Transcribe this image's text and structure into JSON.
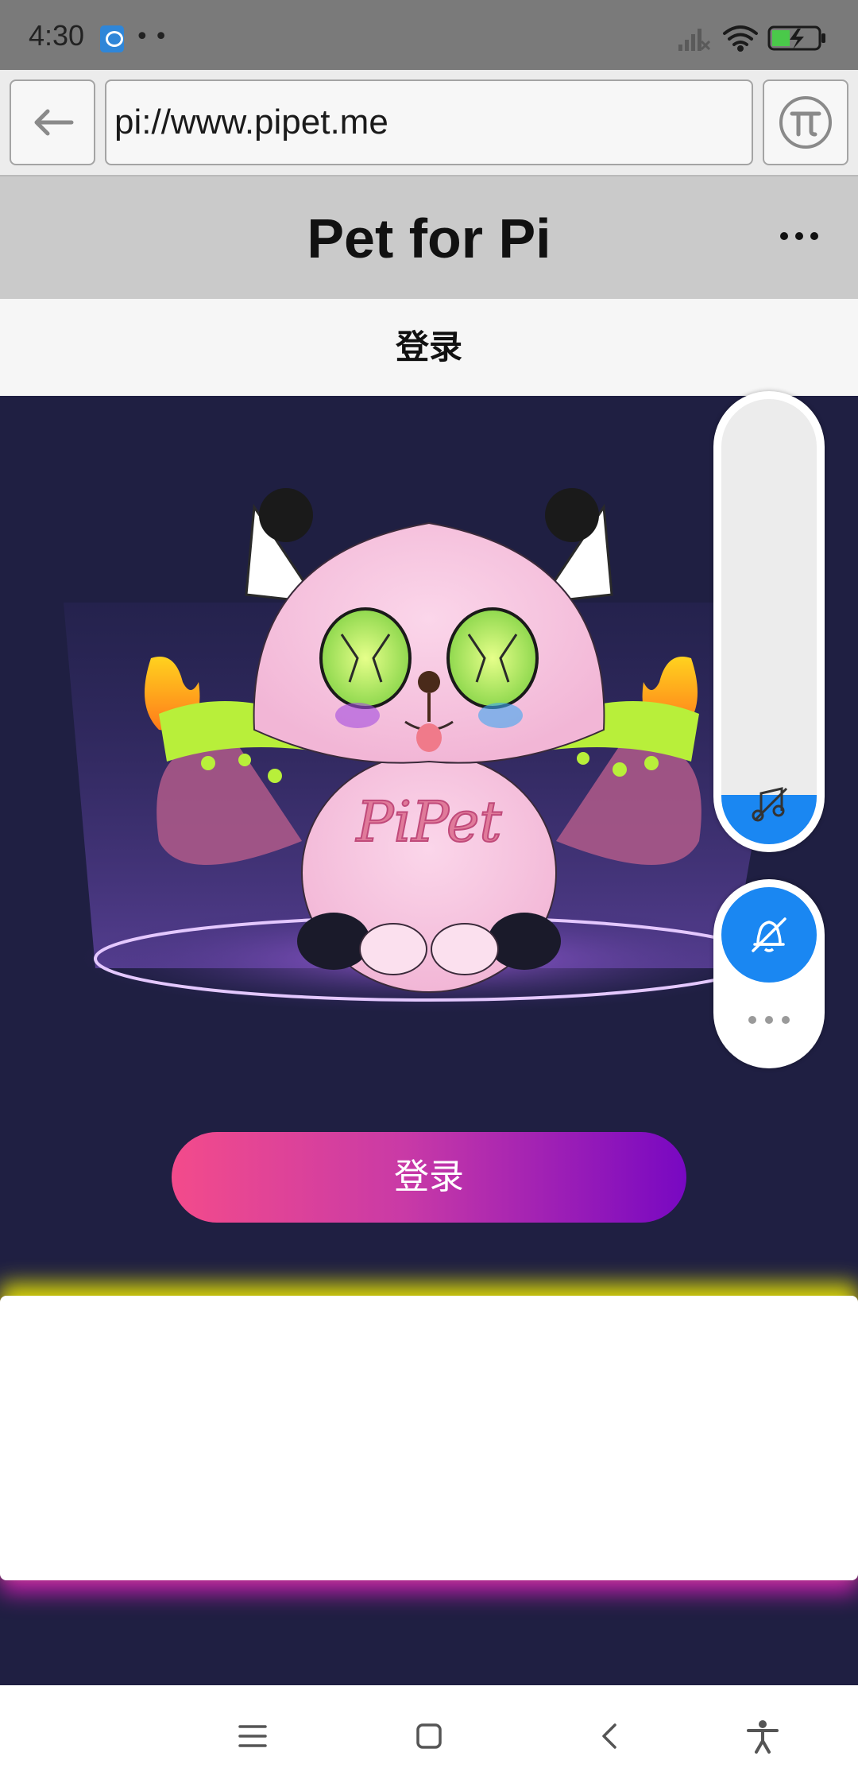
{
  "status_bar": {
    "time": "4:30",
    "notification_dots": "••",
    "icons": [
      "app-notification-icon",
      "signal-off-icon",
      "wifi-icon",
      "battery-charging-icon"
    ]
  },
  "browser": {
    "url": "pi://www.pipet.me",
    "back_icon": "arrow-left-icon",
    "pi_icon": "pi-logo-icon"
  },
  "app_header": {
    "title": "Pet for Pi",
    "more_icon": "more-horizontal-icon"
  },
  "page": {
    "heading": "登录",
    "login_button": "登录",
    "hero_art_text": "PiPet"
  },
  "floating_controls": {
    "volume_level": 0.11,
    "music_icon": "music-off-icon",
    "bell_icon": "bell-off-icon",
    "more_icon": "more-horizontal-icon"
  },
  "colors": {
    "accent": "#1a87f2",
    "hero_background": "#1f1f42",
    "button_gradient_start": "#f34b8b",
    "button_gradient_end": "#7808c2"
  },
  "nav_bar": {
    "items": [
      "menu-icon",
      "home-square-icon",
      "back-chevron-icon",
      "accessibility-icon"
    ]
  }
}
